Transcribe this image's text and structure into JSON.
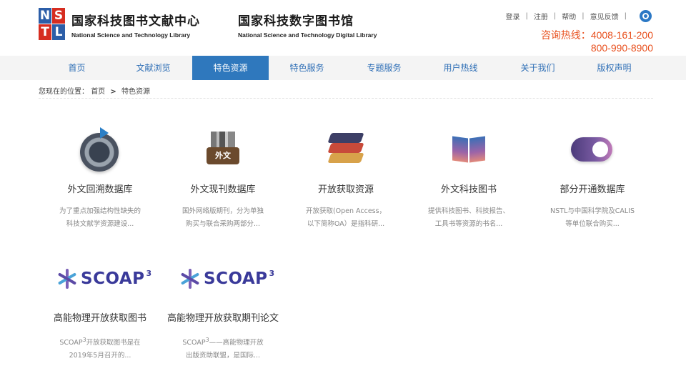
{
  "header": {
    "logo": {
      "letters": [
        "N",
        "S",
        "T",
        "L"
      ]
    },
    "site1": {
      "cn": "国家科技图书文献中心",
      "en": "National Science and Technology Library"
    },
    "site2": {
      "cn": "国家科技数字图书馆",
      "en": "National Science and Technology Digital Library"
    },
    "links": [
      "登录",
      "注册",
      "帮助",
      "意见反馈"
    ],
    "hotline": {
      "label": "咨询热线：",
      "number1": "4008-161-200",
      "number2": "800-990-8900"
    }
  },
  "nav": {
    "items": [
      "首页",
      "文献浏览",
      "特色资源",
      "特色服务",
      "专题服务",
      "用户热线",
      "关于我们",
      "版权声明"
    ],
    "active_index": 2
  },
  "breadcrumb": {
    "prefix": "您现在的位置：",
    "home": "首页",
    "arrow": ">",
    "current": "特色资源"
  },
  "cards": [
    {
      "title": "外文回溯数据库",
      "desc1": "为了重点加强结构性缺失的",
      "desc2": "科技文献学资源建设..."
    },
    {
      "title": "外文现刊数据库",
      "icon_text": "外文",
      "desc1": "国外网络版期刊，分为单独",
      "desc2": "购买与联合采购两部分..."
    },
    {
      "title": "开放获取资源",
      "desc1": "开放获取(Open Access，",
      "desc2": "以下简称OA）是指科研..."
    },
    {
      "title": "外文科技图书",
      "desc1": "提供科技图书、科技报告、",
      "desc2": "工具书等资源的书名..."
    },
    {
      "title": "部分开通数据库",
      "desc1": "NSTL与中国科学院及CALIS",
      "desc2": "等单位联合购买..."
    },
    {
      "title": "高能物理开放获取图书",
      "logo_word": "SCOAP",
      "logo_sup": "3",
      "desc1_a": "SCOAP",
      "desc1_sup": "3",
      "desc1_b": "开放获取图书是在",
      "desc2": "2019年5月召开的..."
    },
    {
      "title": "高能物理开放获取期刊论文",
      "logo_word": "SCOAP",
      "logo_sup": "3",
      "desc1_a": "SCOAP",
      "desc1_sup": "3",
      "desc1_b": "——高能物理开放",
      "desc2": "出版资助联盟，是国际..."
    }
  ],
  "colors": {
    "accent": "#2f78bd",
    "link": "#2f6fb6",
    "hotline": "#e8501e"
  }
}
